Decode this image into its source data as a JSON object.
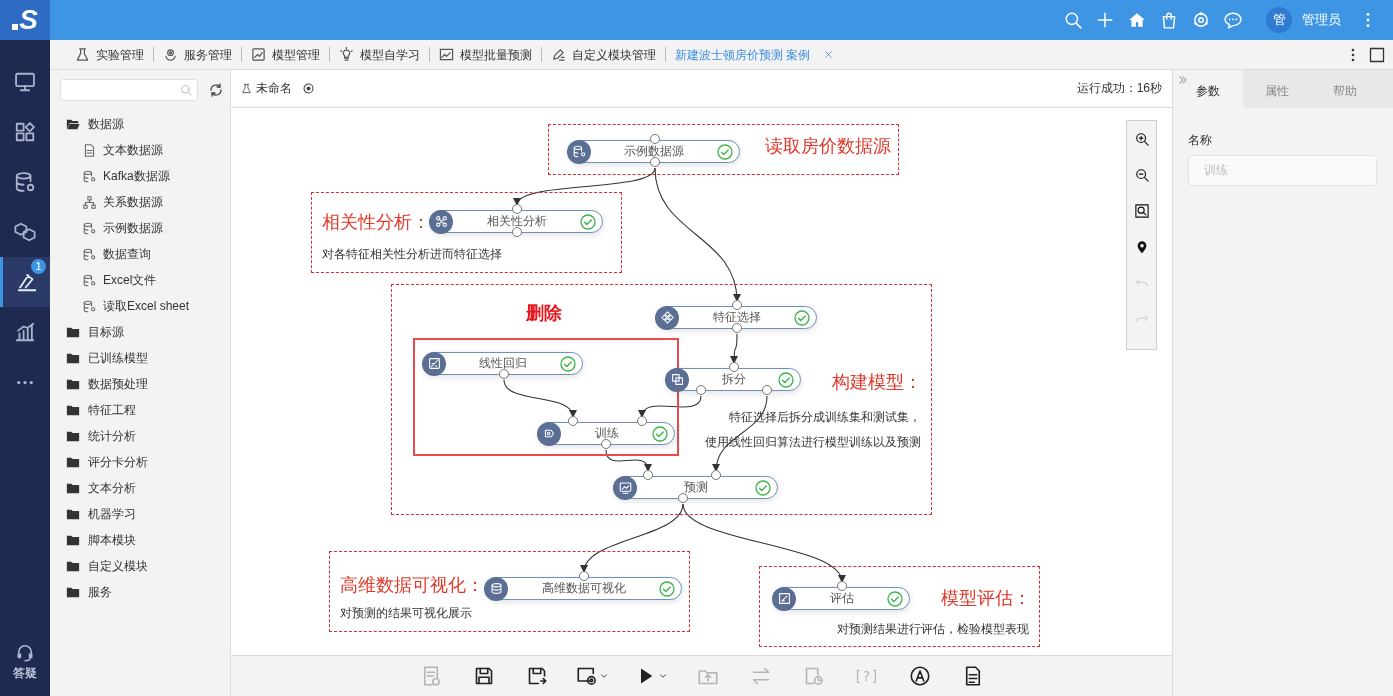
{
  "logo": {
    "text": "S"
  },
  "rail": {
    "items": [
      {
        "kind": "monitor",
        "selected": false
      },
      {
        "kind": "apps",
        "selected": false
      },
      {
        "kind": "database",
        "selected": false
      },
      {
        "kind": "cubes",
        "selected": false
      },
      {
        "kind": "lab",
        "selected": true,
        "badge": "1"
      },
      {
        "kind": "chart",
        "selected": false
      },
      {
        "kind": "more",
        "selected": false
      }
    ],
    "help": {
      "label": "答疑"
    }
  },
  "topbar": {
    "actions": [
      {
        "kind": "search"
      },
      {
        "kind": "add"
      },
      {
        "kind": "home"
      },
      {
        "kind": "bag"
      },
      {
        "kind": "hub"
      },
      {
        "kind": "chat"
      }
    ],
    "avatar": "管",
    "user": "管理员"
  },
  "tabs": [
    {
      "label": "实验管理",
      "kind": "flask",
      "selected": false
    },
    {
      "label": "服务管理",
      "kind": "service",
      "selected": false
    },
    {
      "label": "模型管理",
      "kind": "model",
      "selected": false
    },
    {
      "label": "模型自学习",
      "kind": "bulb",
      "selected": false
    },
    {
      "label": "模型批量预测",
      "kind": "batch",
      "selected": false
    },
    {
      "label": "自定义模块管理",
      "kind": "pencil",
      "selected": false
    },
    {
      "label": "新建波士顿房价预测 案例",
      "selected": true,
      "closable": true
    }
  ],
  "sidebar": {
    "tree": [
      {
        "label": "数据源",
        "expanded": true,
        "children": [
          {
            "label": "文本数据源",
            "kind": "text-source"
          },
          {
            "label": "Kafka数据源",
            "kind": "source"
          },
          {
            "label": "关系数据源",
            "kind": "relation"
          },
          {
            "label": "示例数据源",
            "kind": "source"
          },
          {
            "label": "数据查询",
            "kind": "source"
          },
          {
            "label": "Excel文件",
            "kind": "source"
          },
          {
            "label": "读取Excel sheet",
            "kind": "source"
          }
        ]
      },
      {
        "label": "目标源",
        "expanded": false
      },
      {
        "label": "已训练模型",
        "expanded": false
      },
      {
        "label": "数据预处理",
        "expanded": false
      },
      {
        "label": "特征工程",
        "expanded": false
      },
      {
        "label": "统计分析",
        "expanded": false
      },
      {
        "label": "评分卡分析",
        "expanded": false
      },
      {
        "label": "文本分析",
        "expanded": false
      },
      {
        "label": "机器学习",
        "expanded": false
      },
      {
        "label": "脚本模块",
        "expanded": false
      },
      {
        "label": "自定义模块",
        "expanded": false
      },
      {
        "label": "服务",
        "expanded": false
      }
    ]
  },
  "experiment": {
    "name": "未命名",
    "status": "运行成功：16秒"
  },
  "nodes": [
    {
      "label": "示例数据源",
      "kind": "source",
      "succeeded": true
    },
    {
      "label": "相关性分析",
      "kind": "correlation",
      "succeeded": true
    },
    {
      "label": "特征选择",
      "kind": "feature",
      "succeeded": true
    },
    {
      "label": "线性回归",
      "kind": "regression",
      "succeeded": true
    },
    {
      "label": "拆分",
      "kind": "split",
      "succeeded": true
    },
    {
      "label": "训练",
      "kind": "train",
      "succeeded": true
    },
    {
      "label": "预测",
      "kind": "predict",
      "succeeded": true
    },
    {
      "label": "高维数据可视化",
      "kind": "visualize",
      "succeeded": true
    },
    {
      "label": "评估",
      "kind": "evaluate",
      "succeeded": true
    }
  ],
  "annotations": [
    {
      "title": "读取房价数据源"
    },
    {
      "title": "相关性分析：",
      "lines": [
        "对各特征相关性分析进而特征选择"
      ]
    },
    {
      "title": "构建模型：",
      "lines": [
        "特征选择后拆分成训练集和测试集，",
        "使用线性回归算法进行模型训练以及预测"
      ]
    },
    {
      "title": "高维数据可视化：",
      "lines": [
        "对预测的结果可视化展示"
      ]
    },
    {
      "title": "模型评估：",
      "lines": [
        "对预测结果进行评估，检验模型表现"
      ]
    }
  ],
  "delete_label": "删除",
  "canvas_tools": [
    {
      "kind": "zoom-in",
      "disabled": false
    },
    {
      "kind": "zoom-out",
      "disabled": false
    },
    {
      "kind": "fit",
      "disabled": false
    },
    {
      "kind": "locate",
      "disabled": false
    },
    {
      "kind": "undo",
      "disabled": true
    },
    {
      "kind": "redo",
      "disabled": true
    }
  ],
  "toolbar": [
    {
      "kind": "log",
      "disabled": true
    },
    {
      "kind": "save",
      "disabled": false
    },
    {
      "kind": "save-as",
      "disabled": false
    },
    {
      "kind": "settings",
      "disabled": false,
      "dropdown": true
    },
    {
      "kind": "run",
      "disabled": false,
      "dropdown": true
    },
    {
      "kind": "export",
      "disabled": true
    },
    {
      "kind": "swap",
      "disabled": true
    },
    {
      "kind": "schedule",
      "disabled": true
    },
    {
      "kind": "text",
      "label": "[?]",
      "disabled": true
    },
    {
      "kind": "auto",
      "disabled": false
    },
    {
      "kind": "doc",
      "disabled": false
    }
  ],
  "panel": {
    "tabs": [
      {
        "label": "参数",
        "selected": true
      },
      {
        "label": "属性",
        "selected": false
      },
      {
        "label": "帮助",
        "selected": false
      }
    ],
    "field": {
      "label": "名称",
      "value": "训练",
      "disabled": true
    }
  }
}
